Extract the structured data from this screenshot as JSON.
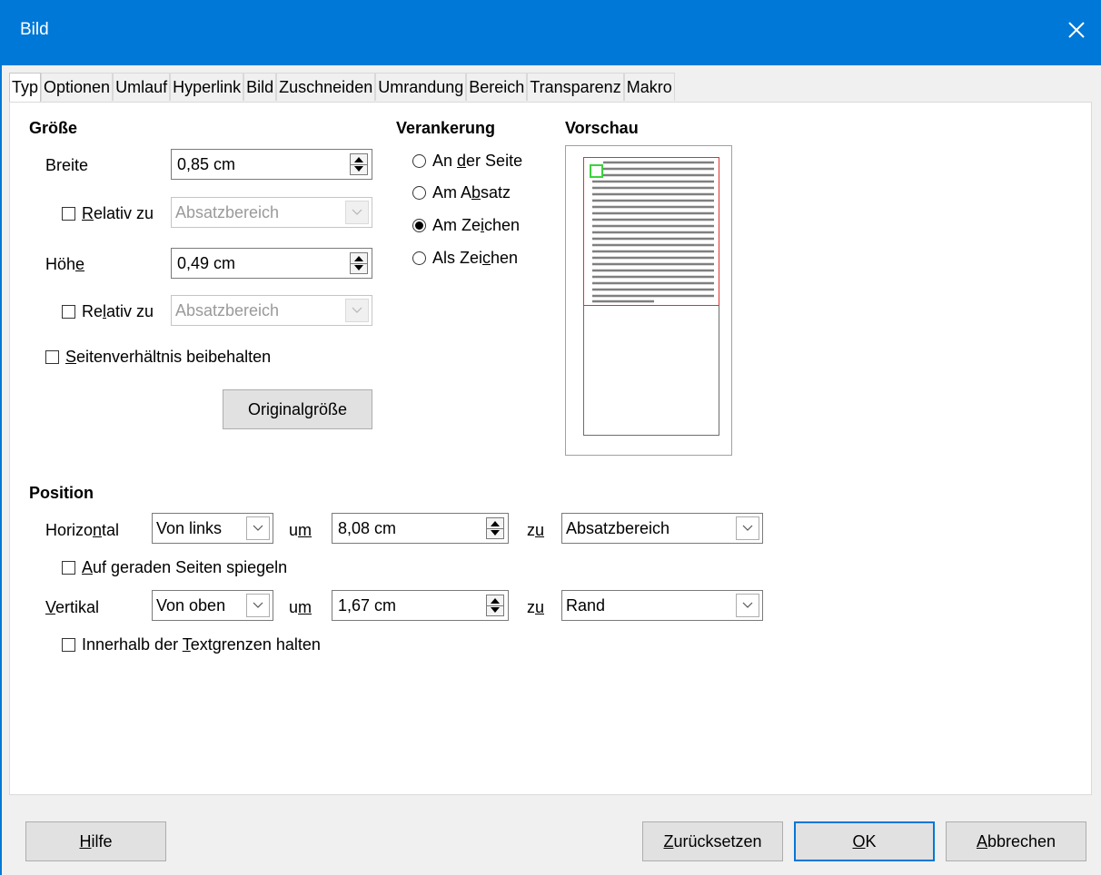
{
  "window": {
    "title": "Bild"
  },
  "tabs": [
    {
      "label": "Typ",
      "active": true
    },
    {
      "label": "Optionen"
    },
    {
      "label": "Umlauf"
    },
    {
      "label": "Hyperlink"
    },
    {
      "label": "Bild"
    },
    {
      "label": "Zuschneiden"
    },
    {
      "label": "Umrandung"
    },
    {
      "label": "Bereich"
    },
    {
      "label": "Transparenz"
    },
    {
      "label": "Makro"
    }
  ],
  "size": {
    "heading": "Größe",
    "width_label_pre": "Breite",
    "width_value": "0,85 cm",
    "rel1_pre": "",
    "rel1_u": "R",
    "rel1_post": "elativ zu",
    "rel1_value": "Absatzbereich",
    "height_label_pre": "Höh",
    "height_label_u": "e",
    "height_value": "0,49 cm",
    "rel2_pre": "Re",
    "rel2_u": "l",
    "rel2_post": "ativ zu",
    "rel2_value": "Absatzbereich",
    "keep_u": "S",
    "keep_post": "eitenverhältnis beibehalten",
    "orig_pre": "Ori",
    "orig_u": "g",
    "orig_post": "inalgröße"
  },
  "anchor": {
    "heading": "Verankerung",
    "opt1_pre": "An ",
    "opt1_u": "d",
    "opt1_post": "er Seite",
    "opt2_pre": "Am A",
    "opt2_u": "b",
    "opt2_post": "satz",
    "opt3_pre": "Am Ze",
    "opt3_u": "i",
    "opt3_post": "chen",
    "opt4_pre": "Als Zei",
    "opt4_u": "c",
    "opt4_post": "hen",
    "selected": "Am Zeichen"
  },
  "preview": {
    "heading": "Vorschau"
  },
  "position": {
    "heading": "Position",
    "h_pre": "Horizo",
    "h_u": "n",
    "h_post": "tal",
    "h_mode": "Von links",
    "by_pre": "u",
    "by_u": "m",
    "by_post": "",
    "h_value": "8,08 cm",
    "to_pre": "z",
    "to_u": "u",
    "to_post": "",
    "h_ref": "Absatzbereich",
    "mirror_u": "A",
    "mirror_post": "uf geraden Seiten spiegeln",
    "v_u": "V",
    "v_post": "ertikal",
    "v_mode": "Von oben",
    "v_value": "1,67 cm",
    "v_ref": "Rand",
    "keep_pre": "Innerhalb der ",
    "keep_u": "T",
    "keep_post": "extgrenzen halten"
  },
  "buttons": {
    "help_u": "H",
    "help_post": "ilfe",
    "reset_pre": "",
    "reset_u": "Z",
    "reset_post": "urücksetzen",
    "ok_u": "O",
    "ok_post": "K",
    "cancel_u": "A",
    "cancel_post": "bbrechen"
  },
  "colors": {
    "accent": "#0078d7",
    "preview_frame": "#e03030",
    "preview_object": "#3cd23c"
  }
}
